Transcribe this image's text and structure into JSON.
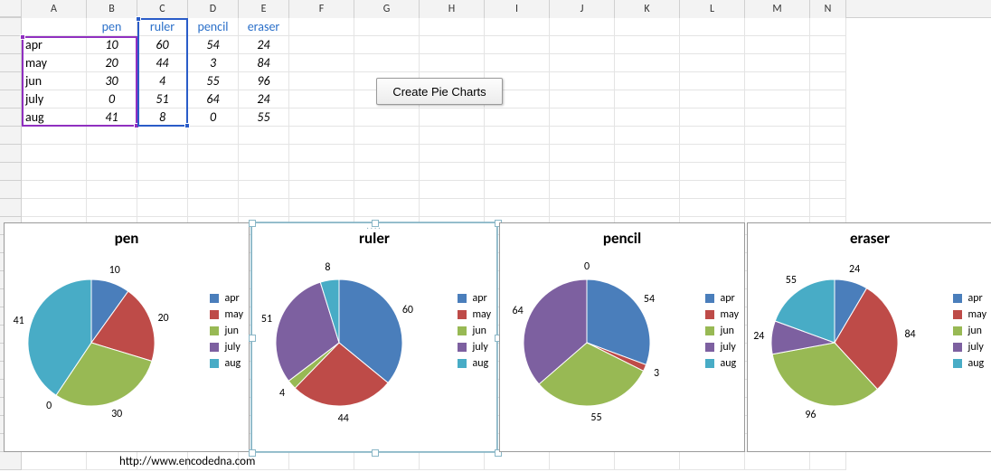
{
  "columns": [
    "A",
    "B",
    "C",
    "D",
    "E",
    "F",
    "G",
    "H",
    "I",
    "J",
    "K",
    "L",
    "M",
    "N"
  ],
  "colWidths": {
    "A": 72,
    "B": 56,
    "C": 56,
    "D": 56,
    "E": 56
  },
  "defaultColWidth": 72,
  "headers": {
    "B": "pen",
    "C": "ruler",
    "D": "pencil",
    "E": "eraser"
  },
  "rowLabels": [
    "apr",
    "may",
    "jun",
    "july",
    "aug"
  ],
  "data": {
    "apr": {
      "pen": 10,
      "ruler": 60,
      "pencil": 54,
      "eraser": 24
    },
    "may": {
      "pen": 20,
      "ruler": 44,
      "pencil": 3,
      "eraser": 84
    },
    "jun": {
      "pen": 30,
      "ruler": 4,
      "pencil": 55,
      "eraser": 96
    },
    "july": {
      "pen": 0,
      "ruler": 51,
      "pencil": 64,
      "eraser": 24
    },
    "aug": {
      "pen": 41,
      "ruler": 8,
      "pencil": 0,
      "eraser": 55
    }
  },
  "button": {
    "label": "Create Pie Charts"
  },
  "colors": {
    "apr": "#4a7ebb",
    "may": "#be4b48",
    "jun": "#98b954",
    "july": "#7d60a0",
    "aug": "#48acc6"
  },
  "credit": "http://www.encodedna.com",
  "chart_data": [
    {
      "type": "pie",
      "title": "pen",
      "categories": [
        "apr",
        "may",
        "jun",
        "july",
        "aug"
      ],
      "values": [
        10,
        20,
        30,
        0,
        41
      ]
    },
    {
      "type": "pie",
      "title": "ruler",
      "categories": [
        "apr",
        "may",
        "jun",
        "july",
        "aug"
      ],
      "values": [
        60,
        44,
        4,
        51,
        8
      ]
    },
    {
      "type": "pie",
      "title": "pencil",
      "categories": [
        "apr",
        "may",
        "jun",
        "july",
        "aug"
      ],
      "values": [
        54,
        3,
        55,
        64,
        0
      ]
    },
    {
      "type": "pie",
      "title": "eraser",
      "categories": [
        "apr",
        "may",
        "jun",
        "july",
        "aug"
      ],
      "values": [
        24,
        84,
        96,
        24,
        55
      ]
    }
  ],
  "selectedChartIndex": 1,
  "selections": [
    {
      "range": "A2:B6",
      "color": "purple"
    },
    {
      "range": "C1:C6",
      "color": "blue"
    }
  ]
}
